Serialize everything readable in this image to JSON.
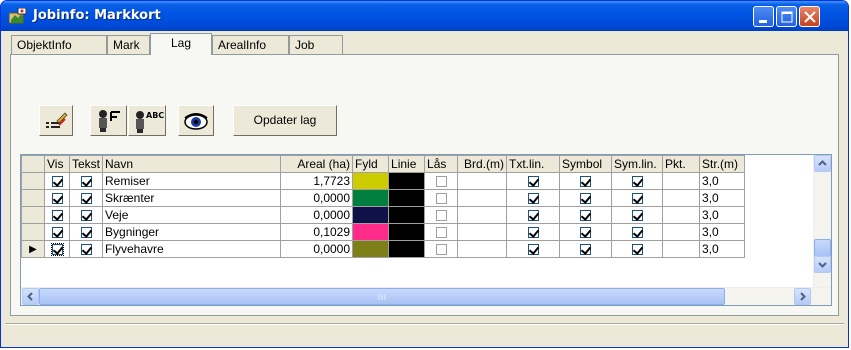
{
  "window": {
    "title": "Jobinfo: Markkort"
  },
  "tabs": [
    {
      "label": "ObjektInfo"
    },
    {
      "label": "Mark"
    },
    {
      "label": "Lag"
    },
    {
      "label": "ArealInfo"
    },
    {
      "label": "Job"
    }
  ],
  "toolbar": {
    "update_label": "Opdater lag"
  },
  "grid": {
    "columns": [
      "Vis",
      "Tekst",
      "Navn",
      "Areal (ha)",
      "Fyld",
      "Linie",
      "Lås",
      "Brd.(m)",
      "Txt.lin.",
      "Symbol",
      "Sym.lin.",
      "Pkt.",
      "Str.(m)"
    ],
    "rows": [
      {
        "vis": true,
        "tekst": true,
        "navn": "Remiser",
        "areal": "1,7723",
        "fyld": "#cccc00",
        "linie": "#000000",
        "laas": false,
        "txtlin": true,
        "symbol": true,
        "symlin": true,
        "str": "3,0"
      },
      {
        "vis": true,
        "tekst": true,
        "navn": "Skrænter",
        "areal": "0,0000",
        "fyld": "#007f3f",
        "linie": "#000000",
        "laas": false,
        "txtlin": true,
        "symbol": true,
        "symlin": true,
        "str": "3,0"
      },
      {
        "vis": true,
        "tekst": true,
        "navn": "Veje",
        "areal": "0,0000",
        "fyld": "#11114a",
        "linie": "#000000",
        "laas": false,
        "txtlin": true,
        "symbol": true,
        "symlin": true,
        "str": "3,0"
      },
      {
        "vis": true,
        "tekst": true,
        "navn": "Bygninger",
        "areal": "0,1029",
        "fyld": "#ff2a8a",
        "linie": "#000000",
        "laas": false,
        "txtlin": true,
        "symbol": true,
        "symlin": true,
        "str": "3,0"
      },
      {
        "vis": true,
        "tekst": true,
        "navn": "Flyvehavre",
        "areal": "0,0000",
        "fyld": "#7f7f1a",
        "linie": "#000000",
        "laas": false,
        "txtlin": true,
        "symbol": true,
        "symlin": true,
        "str": "3,0"
      }
    ],
    "current_row_indicator": "▶"
  }
}
